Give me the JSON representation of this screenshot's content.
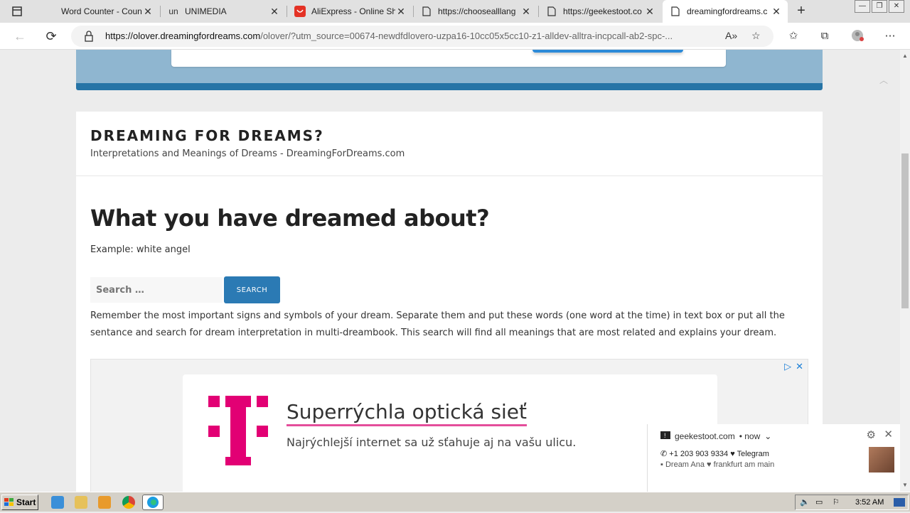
{
  "browser": {
    "tabs": [
      {
        "title": "Word Counter - Count",
        "favicon": "document-icon",
        "active": false
      },
      {
        "title": "UNIMEDIA",
        "favicon": "un",
        "active": false
      },
      {
        "title": "AliExpress - Online Sh",
        "favicon": "aliexpress-icon",
        "active": false
      },
      {
        "title": "https://choosealllang",
        "favicon": "page-icon",
        "active": false
      },
      {
        "title": "https://geekestoot.co",
        "favicon": "page-icon",
        "active": false
      },
      {
        "title": "dreamingfordreams.c",
        "favicon": "page-icon",
        "active": true
      }
    ],
    "url_host": "https://olover.dreamingfordreams.com",
    "url_path": "/olover/?utm_source=00674-newdfdlovero-uzpa16-10cc05x5cc10-z1-alldev-alltra-incpcall-ab2-spc-..."
  },
  "site": {
    "title": "DREAMING FOR DREAMS?",
    "description": "Interpretations and Meanings of Dreams - DreamingForDreams.com"
  },
  "main": {
    "heading": "What you have dreamed about?",
    "example": "Example: white angel",
    "search_placeholder": "Search …",
    "search_button": "SEARCH",
    "description": "Remember the most important signs and symbols of your dream. Separate them and put these words (one word at the time) in text box or put all the sentance and search for dream interpretation in multi-dreambook. This search will find all meanings that are most related and explains your dream."
  },
  "ad": {
    "headline": "Superrýchla optická sieť",
    "subline": "Najrýchlejší internet sa už sťahuje aj na vašu ulicu.",
    "brand_color": "#e20074"
  },
  "notification": {
    "source": "geekestoot.com",
    "time": "• now",
    "line1": "+1 203 903 9334 ♥ Telegram",
    "line2": "Dream Ana ♥ frankfurt am main"
  },
  "taskbar": {
    "start_label": "Start",
    "clock": "3:52 AM"
  }
}
